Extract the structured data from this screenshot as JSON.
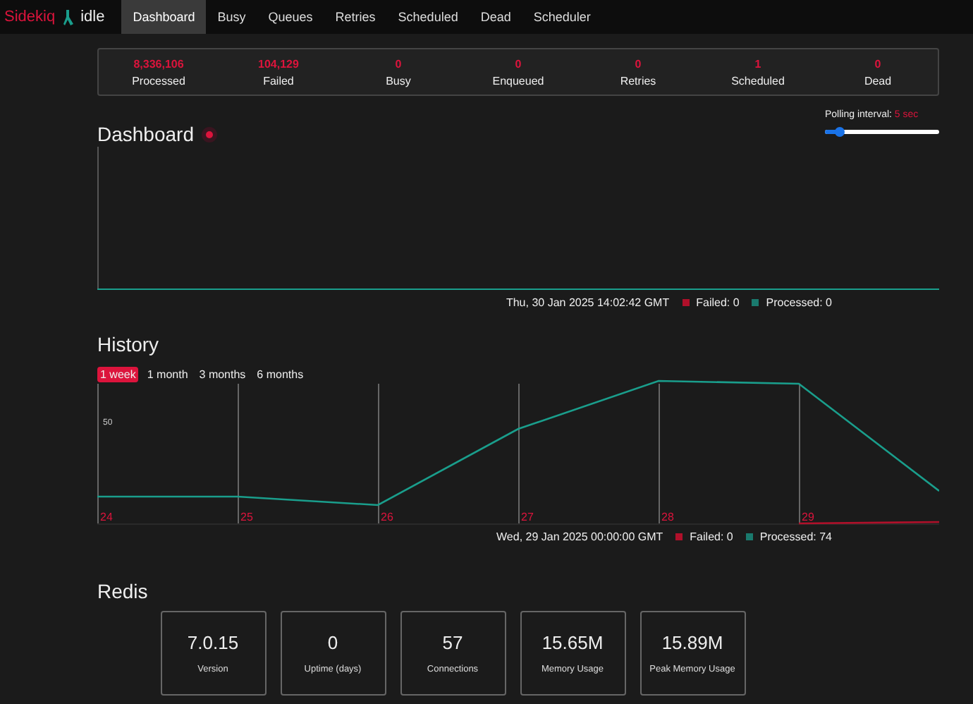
{
  "brand": {
    "name": "Sidekiq",
    "status": "idle"
  },
  "nav": [
    {
      "label": "Dashboard",
      "selected": true
    },
    {
      "label": "Busy",
      "selected": false
    },
    {
      "label": "Queues",
      "selected": false
    },
    {
      "label": "Retries",
      "selected": false
    },
    {
      "label": "Scheduled",
      "selected": false
    },
    {
      "label": "Dead",
      "selected": false
    },
    {
      "label": "Scheduler",
      "selected": false
    }
  ],
  "stats": [
    {
      "value": "8,336,106",
      "label": "Processed"
    },
    {
      "value": "104,129",
      "label": "Failed"
    },
    {
      "value": "0",
      "label": "Busy"
    },
    {
      "value": "0",
      "label": "Enqueued"
    },
    {
      "value": "0",
      "label": "Retries"
    },
    {
      "value": "1",
      "label": "Scheduled"
    },
    {
      "value": "0",
      "label": "Dead"
    }
  ],
  "dashboard": {
    "title": "Dashboard",
    "polling_label": "Polling interval:",
    "polling_value": "5 sec",
    "polling": {
      "level": 0.15
    },
    "legend": {
      "time": "Thu, 30 Jan 2025 14:02:42 GMT",
      "failed": "Failed: 0",
      "processed": "Processed: 0"
    }
  },
  "history": {
    "title": "History",
    "ranges": [
      {
        "label": "1 week",
        "selected": true
      },
      {
        "label": "1 month",
        "selected": false
      },
      {
        "label": "3 months",
        "selected": false
      },
      {
        "label": "6 months",
        "selected": false
      }
    ],
    "y_label": "50",
    "x_labels": [
      "24",
      "25",
      "26",
      "27",
      "28",
      "29"
    ],
    "legend": {
      "time": "Wed, 29 Jan 2025 00:00:00 GMT",
      "failed": "Failed: 0",
      "processed": "Processed: 74"
    }
  },
  "redis": {
    "title": "Redis",
    "cards": [
      {
        "value": "7.0.15",
        "label": "Version"
      },
      {
        "value": "0",
        "label": "Uptime (days)"
      },
      {
        "value": "57",
        "label": "Connections"
      },
      {
        "value": "15.65M",
        "label": "Memory Usage"
      },
      {
        "value": "15.89M",
        "label": "Peak Memory Usage"
      }
    ]
  }
}
